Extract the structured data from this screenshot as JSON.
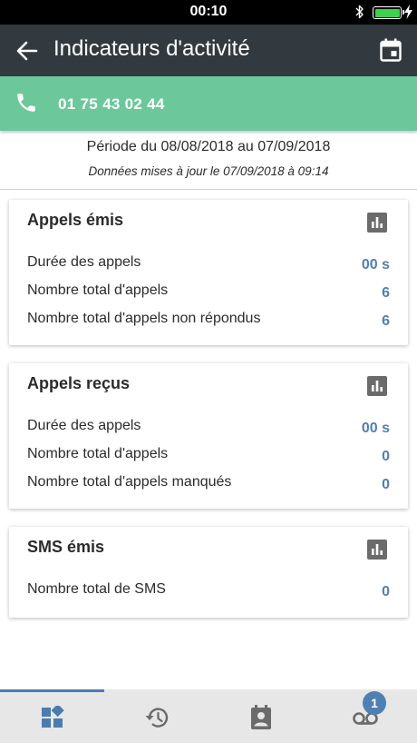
{
  "status_bar": {
    "time": "00:10"
  },
  "app_bar": {
    "title": "Indicateurs d'activité"
  },
  "phone": {
    "number": "01 75 43 02 44"
  },
  "period": {
    "range": "Période du 08/08/2018 au 07/09/2018",
    "updated": "Données mises à jour le 07/09/2018 à 09:14"
  },
  "cards": [
    {
      "title": "Appels émis",
      "rows": [
        {
          "label": "Durée des appels",
          "value": "00 s"
        },
        {
          "label": "Nombre total d'appels",
          "value": "6"
        },
        {
          "label": "Nombre total d'appels non répondus",
          "value": "6"
        }
      ]
    },
    {
      "title": "Appels reçus",
      "rows": [
        {
          "label": "Durée des appels",
          "value": "00 s"
        },
        {
          "label": "Nombre total d'appels",
          "value": "0"
        },
        {
          "label": "Nombre total d'appels manqués",
          "value": "0"
        }
      ]
    },
    {
      "title": "SMS émis",
      "rows": [
        {
          "label": "Nombre total de SMS",
          "value": "0"
        }
      ]
    }
  ],
  "bottom_nav": {
    "items": [
      {
        "icon": "dashboard-icon",
        "active": true
      },
      {
        "icon": "history-icon",
        "active": false
      },
      {
        "icon": "contacts-icon",
        "active": false
      },
      {
        "icon": "voicemail-icon",
        "active": false,
        "badge": "1"
      }
    ]
  },
  "colors": {
    "app_bar": "#333a3f",
    "phone_bar": "#6cc89b",
    "value_accent": "#4f7fb3",
    "nav_background": "#e7e7e7",
    "battery": "#3fd04c"
  }
}
